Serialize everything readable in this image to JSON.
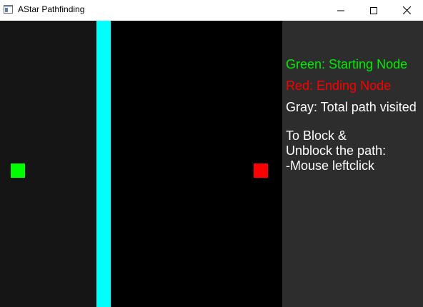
{
  "window": {
    "title": "AStar Pathfinding",
    "icon": "app-window-icon",
    "controls": {
      "minimize_icon": "minimize-icon",
      "maximize_icon": "maximize-icon",
      "close_icon": "close-icon"
    }
  },
  "grid": {
    "left_region_color": "#151515",
    "right_region_color": "#000000",
    "wall_color": "#00ffff",
    "start_node_color": "#00ff00",
    "end_node_color": "#ff0000"
  },
  "panel": {
    "background": "#2d2d2d",
    "legend": {
      "green": "Green: Starting Node",
      "red": "Red: Ending Node",
      "gray": "Gray: Total path visited"
    },
    "instructions": {
      "line1": "To Block &",
      "line2": "Unblock the path:",
      "line3": "-Mouse leftclick"
    }
  }
}
